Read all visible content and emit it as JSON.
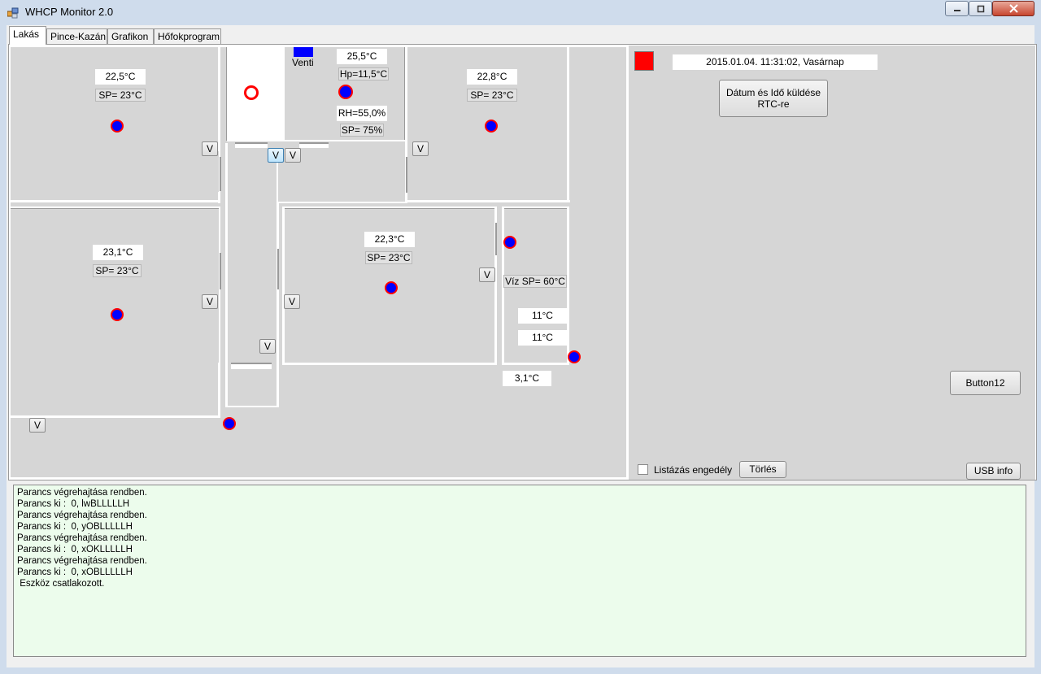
{
  "window": {
    "title": "WHCP Monitor 2.0"
  },
  "tabs": [
    {
      "label": "Lakás",
      "active": true
    },
    {
      "label": "Pince-Kazán",
      "active": false
    },
    {
      "label": "Grafikon",
      "active": false
    },
    {
      "label": "Hőfokprogram",
      "active": false
    }
  ],
  "rooms": {
    "top_left": {
      "temp": "22,5°C",
      "sp": "SP= 23°C"
    },
    "bathroom": {
      "venti_label": "Venti",
      "temp": "25,5°C",
      "hp": "Hp=11,5°C",
      "rh": "RH=55,0%",
      "sp": "SP= 75%"
    },
    "top_right": {
      "temp": "22,8°C",
      "sp": "SP= 23°C"
    },
    "bottom_left": {
      "temp": "23,1°C",
      "sp": "SP= 23°C"
    },
    "center": {
      "temp": "22,3°C",
      "sp": "SP= 23°C"
    },
    "water": {
      "sp": "Víz SP= 60°C",
      "temp1": "11°C",
      "temp2": "11°C",
      "outdoor": "3,1°C"
    }
  },
  "valve_label": "V",
  "status": {
    "datetime": "2015.01.04. 11:31:02,  Vasárnap",
    "indicator_color": "#ff0000",
    "send_rtc_button": "Dátum és Idő küldése RTC-re",
    "button12": "Button12",
    "listing_checkbox": "Listázás engedély",
    "listing_checked": false,
    "clear_button": "Törlés",
    "usb_info_button": "USB info"
  },
  "log": [
    "Parancs végrehajtása rendben.",
    "Parancs ki :  0, lwBLLLLLH",
    "Parancs végrehajtása rendben.",
    "Parancs ki :  0, yOBLLLLLH",
    "Parancs végrehajtása rendben.",
    "Parancs ki :  0, xOKLLLLLH",
    "Parancs végrehajtása rendben.",
    "Parancs ki :  0, xOBLLLLLH",
    " Eszköz csatlakozott."
  ]
}
